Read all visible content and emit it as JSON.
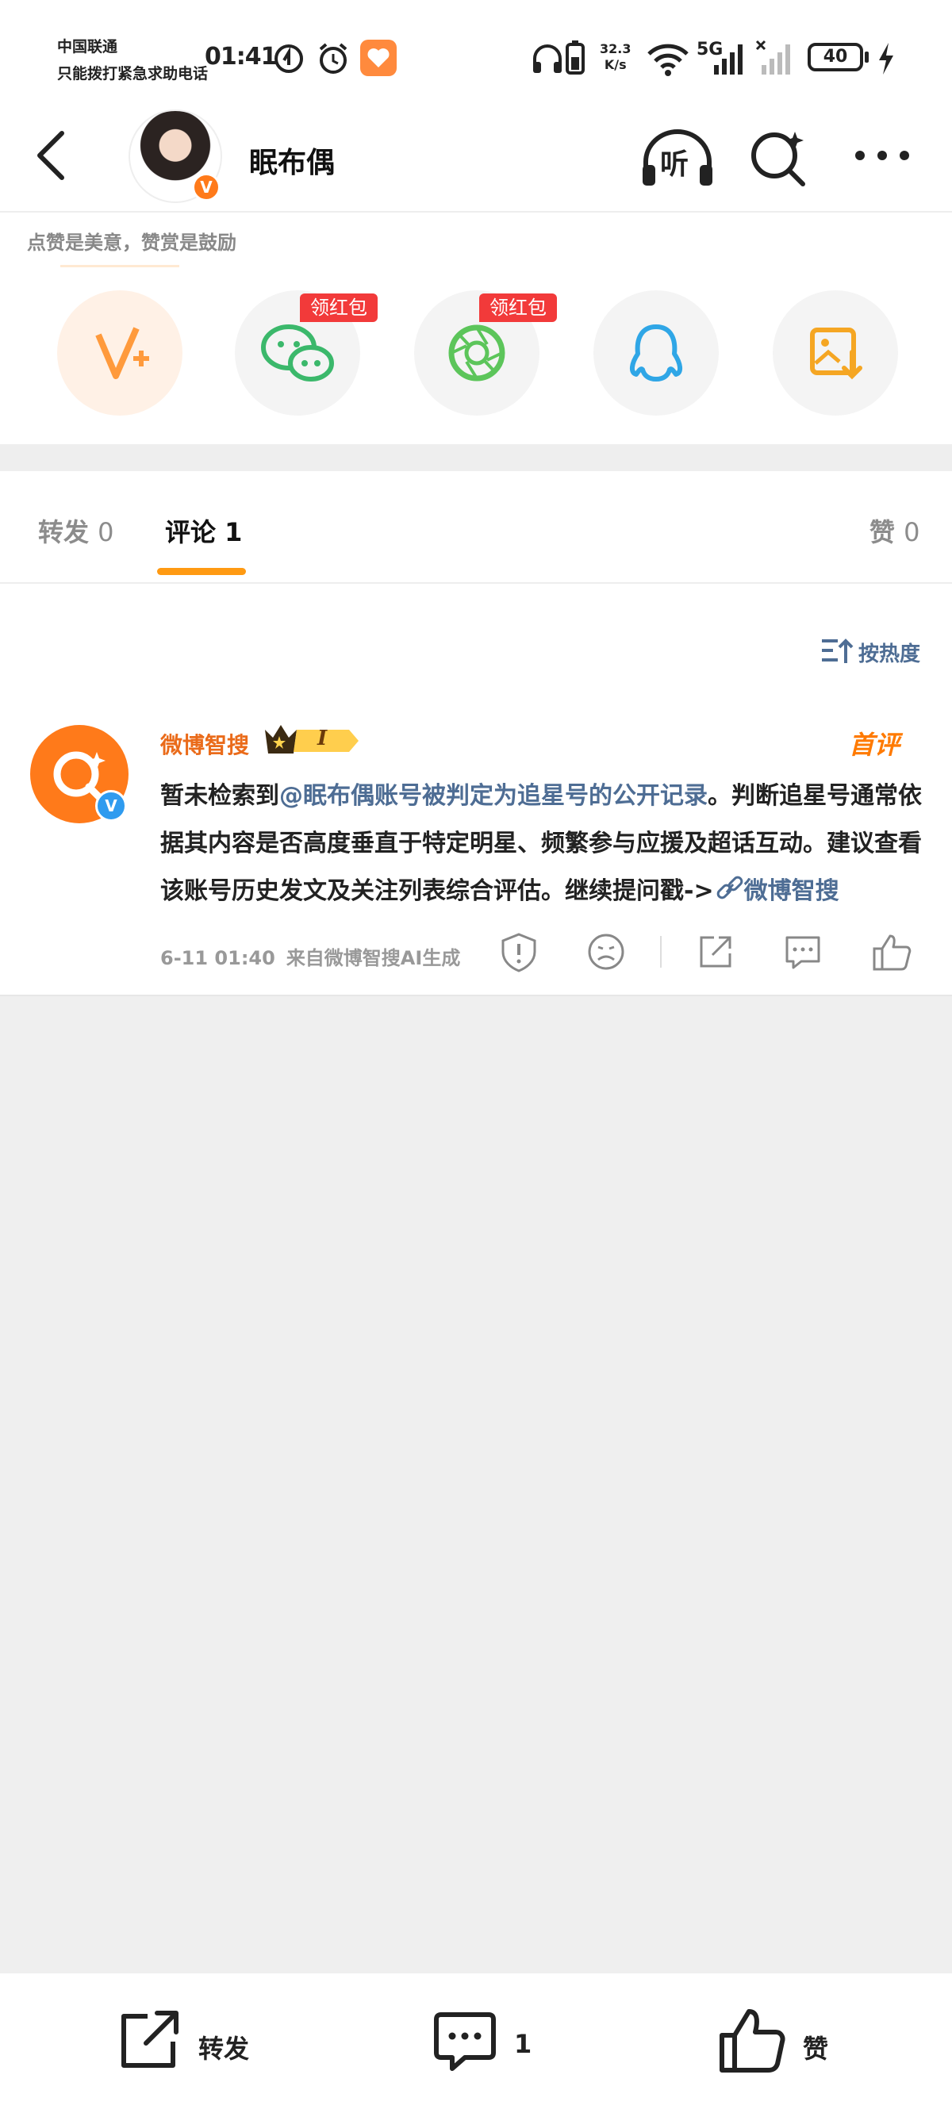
{
  "status_bar": {
    "carrier_line1": "中国联通",
    "carrier_line2": "只能拨打紧急求助电话",
    "time": "01:41",
    "net_speed": "32.3",
    "net_unit": "K/s",
    "network": "5G",
    "battery": "40"
  },
  "header": {
    "username": "眠布偶",
    "listen_label": "听",
    "verified_badge": "V"
  },
  "share_panel": {
    "encourage_text": "点赞是美意，赞赏是鼓励",
    "redpack_label": "领红包",
    "items": [
      {
        "icon": "vplus-icon",
        "redpack": false
      },
      {
        "icon": "wechat-icon",
        "redpack": true
      },
      {
        "icon": "moments-icon",
        "redpack": true
      },
      {
        "icon": "qq-icon",
        "redpack": false
      },
      {
        "icon": "save-image-icon",
        "redpack": false
      }
    ]
  },
  "tabs": {
    "repost_label": "转发",
    "repost_count": "0",
    "comment_label": "评论",
    "comment_count": "1",
    "like_label": "赞",
    "like_count": "0"
  },
  "sort": {
    "label": "按热度"
  },
  "comment": {
    "author": "微博智搜",
    "rank_badge": "I",
    "first_label": "首评",
    "text_part1": "暂未检索到",
    "mention": "@眠布偶账号被判定为追星号的公开记录",
    "text_part2": "。判断追星号通常依据其内容是否高度垂直于特定明星、频繁参与应援及超话互动。建议查看该账号历史发文及关注列表综合评估。继续提问戳->",
    "link_label": "微博智搜",
    "time": "6-11 01:40",
    "source": "来自微博智搜AI生成"
  },
  "bottom_bar": {
    "repost_label": "转发",
    "comment_count": "1",
    "like_label": "赞"
  },
  "colors": {
    "accent_orange": "#ff9a12",
    "link_blue": "#4e6d94",
    "redpack_red": "#f23a3a",
    "author_orange": "#ea6b1a"
  }
}
